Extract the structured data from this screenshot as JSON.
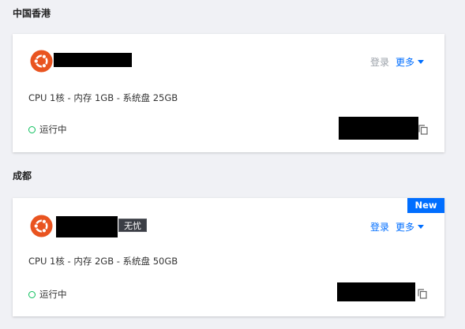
{
  "regions": [
    {
      "name": "中国香港",
      "instance": {
        "login_label": "登录",
        "login_enabled": false,
        "more_label": "更多",
        "spec": "CPU 1核 - 内存 1GB - 系统盘 25GB",
        "status": "运行中"
      }
    },
    {
      "name": "成都",
      "instance": {
        "badge": "无忧",
        "new_label": "New",
        "login_label": "登录",
        "login_enabled": true,
        "more_label": "更多",
        "spec": "CPU 1核 - 内存 2GB - 系统盘 50GB",
        "status": "运行中"
      }
    }
  ],
  "colors": {
    "accent": "#006eff",
    "running": "#0abf5b",
    "ubuntu": "#e95420",
    "disabled_link": "#9aa0a8"
  },
  "icons": {
    "os": "ubuntu-logo",
    "copy": "copy-icon",
    "status": "status-dot"
  }
}
